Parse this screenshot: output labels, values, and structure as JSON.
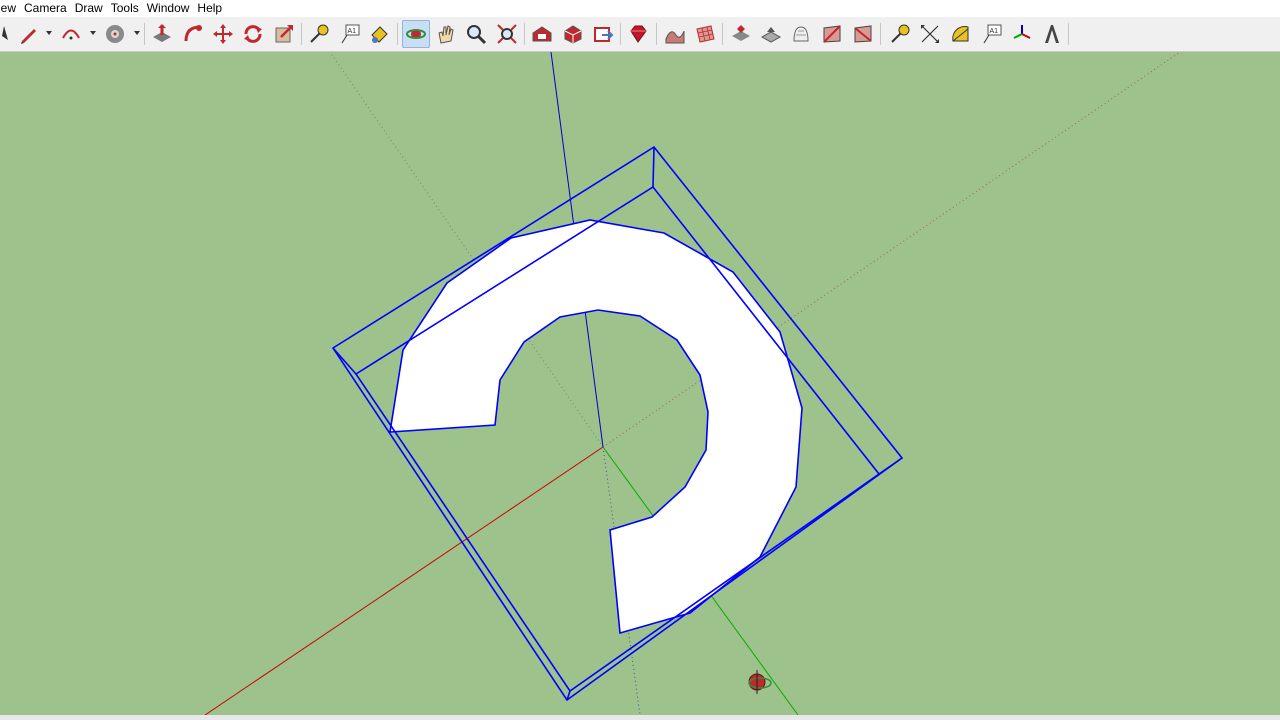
{
  "menu": [
    "View",
    "Camera",
    "Draw",
    "Tools",
    "Window",
    "Help"
  ],
  "menu_display": [
    "iew",
    "Camera",
    "Draw",
    "Tools",
    "Window",
    "Help"
  ],
  "colors": {
    "viewport_bg": "#9dc28c",
    "selection": "#0000ff",
    "axis_red": "#cc0000",
    "axis_green": "#00aa00",
    "axis_blue": "#0000cc",
    "face": "#ffffff"
  },
  "toolbar_icons": [
    "select-icon",
    "pencil-line-icon",
    "arc-icon",
    "eraser-paint-icon",
    "push-pull-icon",
    "follow-me-icon",
    "move-icon",
    "rotate-icon",
    "scale-icon",
    "tape-measure-icon",
    "text-icon",
    "paint-bucket-icon",
    "orbit-icon",
    "pan-icon",
    "zoom-icon",
    "zoom-extents-icon",
    "warehouse-icon",
    "components-icon",
    "share-model-icon",
    "ruby-icon",
    "sandbox-smoove-icon",
    "sandbox-grid-icon",
    "sandbox-stamp-icon",
    "sandbox-drape-icon",
    "sandbox-add-detail-icon",
    "sandbox-flip-edge-icon",
    "sandbox-from-contours-icon",
    "tape-measure-2-icon",
    "dimensions-icon",
    "protractor-icon",
    "text-2-icon",
    "axes-icon",
    "3d-text-icon"
  ],
  "active_tool": "orbit-icon"
}
